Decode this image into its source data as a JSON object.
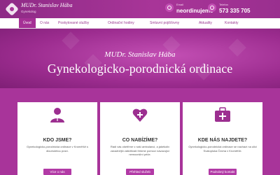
{
  "header": {
    "brand_name": "MUDr. Stanislav Hába",
    "brand_sub": "Gynekolog",
    "info1_label": "Email",
    "info1_value": "neordinujeme",
    "info2_label": "Telefon",
    "info2_value": "573 335 705"
  },
  "nav": {
    "items": [
      "Úvod",
      "O nás",
      "Poskytované služby",
      "Ordinační hodiny",
      "Smluvní pojišťovny",
      "Aktuality",
      "Kontakty"
    ],
    "active_index": 0
  },
  "hero": {
    "name": "MUDr. Stanislav Hába",
    "title": "Gynekologicko-porodnická ordinace"
  },
  "cards": [
    {
      "icon": "doctor-icon",
      "title": "KDO JSME?",
      "text": "Gynekologicko-porodnická ordinace v Kroměříži s dlouholetou praxí.",
      "button": "Více o nás"
    },
    {
      "icon": "heart-plus-icon",
      "title": "CO NABÍZÍME?",
      "text": "Rádi vás ošetříme v naší ambulanci, a jakékoliv zavažnější záležitosti řešíme pomocí navazující nemocniční péče.",
      "button": "Přehled služeb"
    },
    {
      "icon": "medical-kit-icon",
      "title": "KDE NÁS NAJDETE?",
      "text": "Gynekologicko-porodnická ordinace se nachází na ulici Svatopluka Čecha v Kroměříži.",
      "button": "Podrobný kontakt"
    }
  ],
  "colors": {
    "brand": "#a53095",
    "nav_text": "#9b3a92",
    "button": "#b23aa6"
  }
}
